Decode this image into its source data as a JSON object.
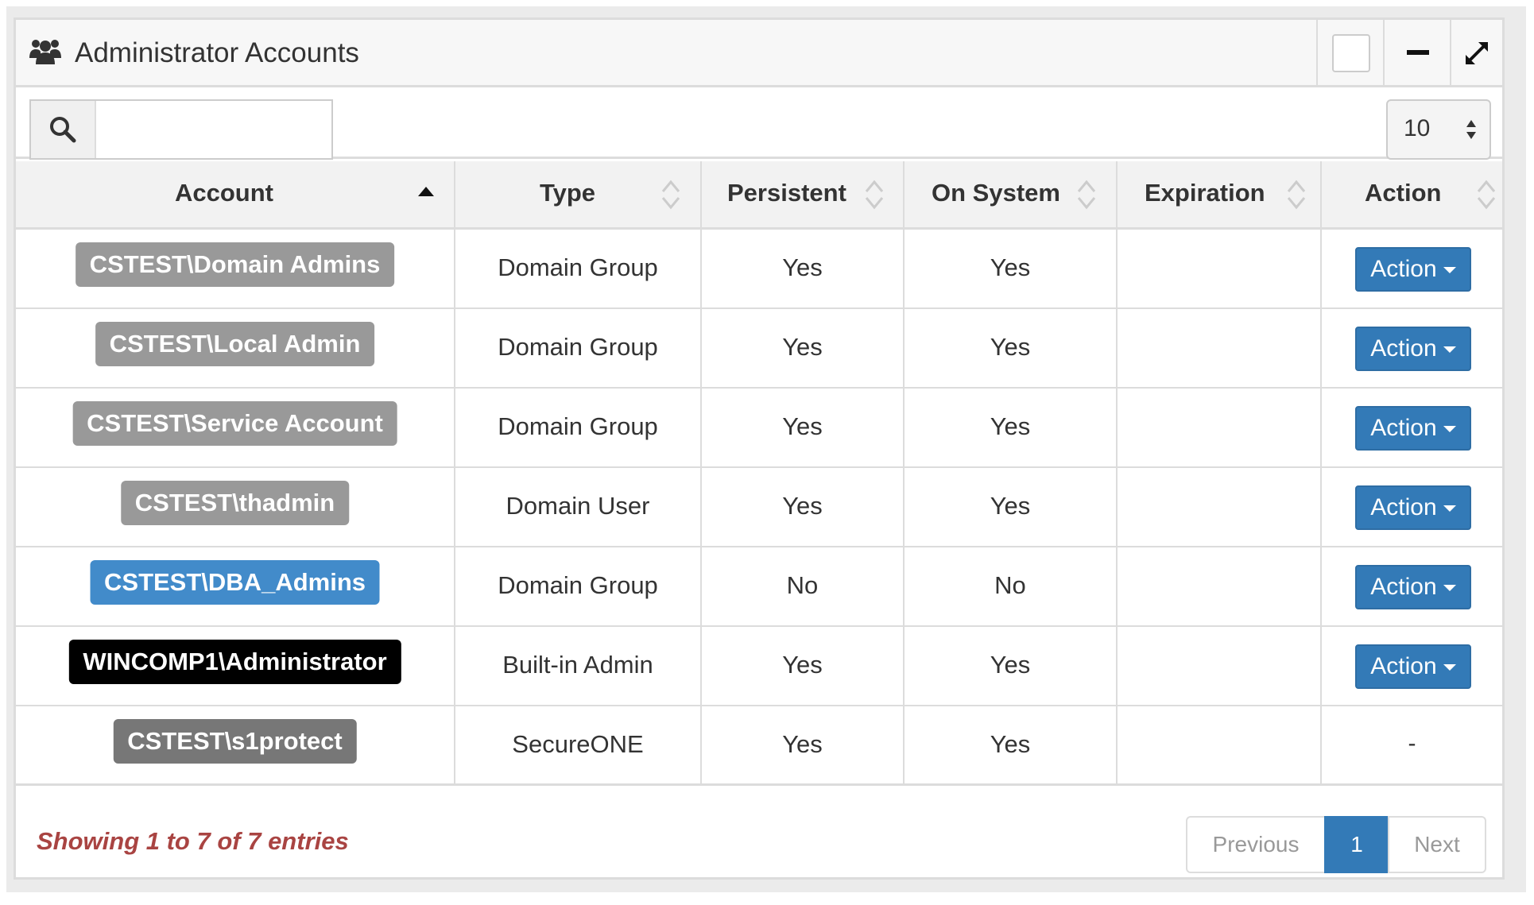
{
  "panel": {
    "title": "Administrator Accounts",
    "icons": [
      "users-icon",
      "checkbox-icon",
      "minimize-icon",
      "expand-icon"
    ]
  },
  "toolbar": {
    "search_value": "",
    "page_size": "10"
  },
  "table": {
    "headers": {
      "account": "Account",
      "type": "Type",
      "persistent": "Persistent",
      "on_system": "On System",
      "expiration": "Expiration",
      "action": "Action"
    },
    "sorted_column": "Account",
    "sort_direction": "ascending",
    "rows": [
      {
        "account": "CSTEST\\Domain Admins",
        "label_color": "#999999",
        "type": "Domain Group",
        "persistent": "Yes",
        "on_system": "Yes",
        "expiration": "",
        "action": "Action"
      },
      {
        "account": "CSTEST\\Local Admin",
        "label_color": "#999999",
        "type": "Domain Group",
        "persistent": "Yes",
        "on_system": "Yes",
        "expiration": "",
        "action": "Action"
      },
      {
        "account": "CSTEST\\Service Account",
        "label_color": "#999999",
        "type": "Domain Group",
        "persistent": "Yes",
        "on_system": "Yes",
        "expiration": "",
        "action": "Action"
      },
      {
        "account": "CSTEST\\thadmin",
        "label_color": "#999999",
        "type": "Domain User",
        "persistent": "Yes",
        "on_system": "Yes",
        "expiration": "",
        "action": "Action"
      },
      {
        "account": "CSTEST\\DBA_Admins",
        "label_color": "#428bca",
        "type": "Domain Group",
        "persistent": "No",
        "on_system": "No",
        "expiration": "",
        "action": "Action"
      },
      {
        "account": "WINCOMP1\\Administrator",
        "label_color": "#000000",
        "type": "Built-in Admin",
        "persistent": "Yes",
        "on_system": "Yes",
        "expiration": "",
        "action": "Action"
      },
      {
        "account": "CSTEST\\s1protect",
        "label_color": "#777777",
        "type": "SecureONE",
        "persistent": "Yes",
        "on_system": "Yes",
        "expiration": "",
        "action": "-"
      }
    ]
  },
  "footer": {
    "info": "Showing 1 to 7 of 7 entries",
    "pagination": {
      "previous": "Previous",
      "current": "1",
      "next": "Next"
    }
  },
  "colors": {
    "primary": "#337ab7",
    "info_text": "#a94442",
    "label_gray": "#999999",
    "label_blue": "#428bca",
    "label_black": "#000000"
  }
}
